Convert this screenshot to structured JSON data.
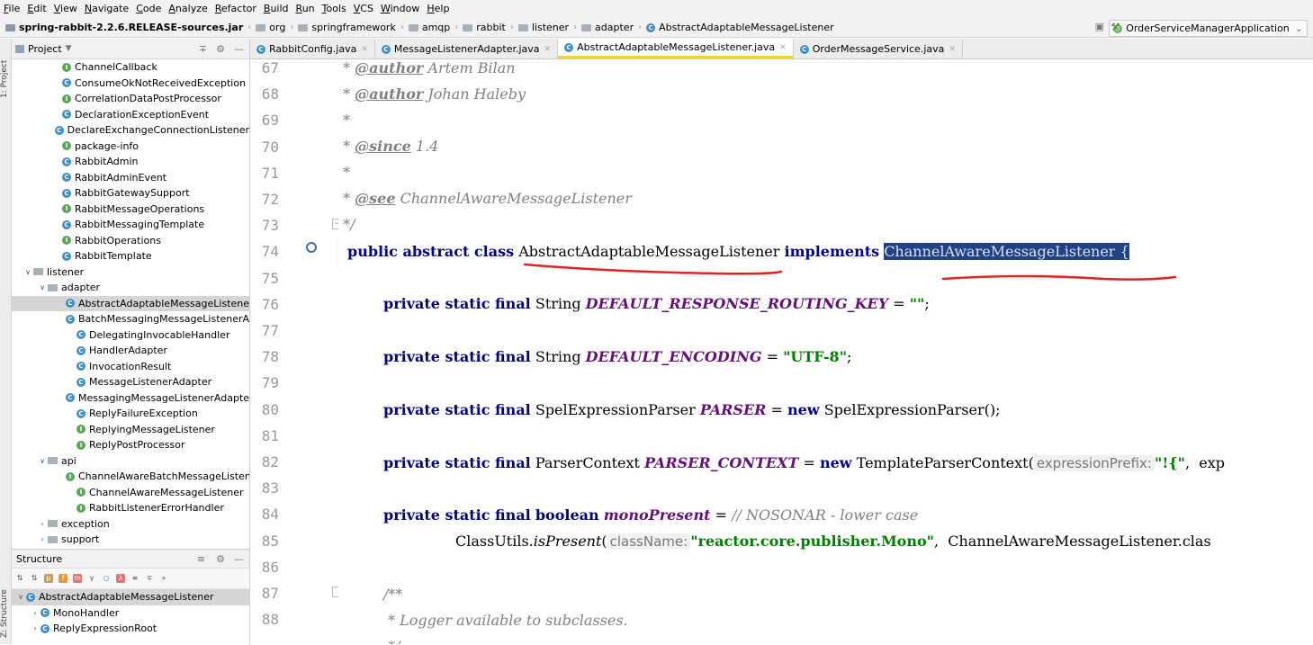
{
  "menu": [
    "File",
    "Edit",
    "View",
    "Navigate",
    "Code",
    "Analyze",
    "Refactor",
    "Build",
    "Run",
    "Tools",
    "VCS",
    "Window",
    "Help"
  ],
  "breadcrumbs": [
    "spring-rabbit-2.2.6.RELEASE-sources.jar",
    "org",
    "springframework",
    "amqp",
    "rabbit",
    "listener",
    "adapter",
    "AbstractAdaptableMessageListener"
  ],
  "run_config": "OrderServiceManagerApplication",
  "left_strip": {
    "project": "1: Project",
    "structure": "Z: Structure"
  },
  "project_panel": {
    "title": "Project",
    "items": [
      {
        "label": "ChannelCallback",
        "indent": 3,
        "icon": "I"
      },
      {
        "label": "ConsumeOkNotReceivedException",
        "indent": 3,
        "icon": "C"
      },
      {
        "label": "CorrelationDataPostProcessor",
        "indent": 3,
        "icon": "I"
      },
      {
        "label": "DeclarationExceptionEvent",
        "indent": 3,
        "icon": "C"
      },
      {
        "label": "DeclareExchangeConnectionListener",
        "indent": 3,
        "icon": "C"
      },
      {
        "label": "package-info",
        "indent": 3,
        "icon": "I"
      },
      {
        "label": "RabbitAdmin",
        "indent": 3,
        "icon": "C"
      },
      {
        "label": "RabbitAdminEvent",
        "indent": 3,
        "icon": "C"
      },
      {
        "label": "RabbitGatewaySupport",
        "indent": 3,
        "icon": "C"
      },
      {
        "label": "RabbitMessageOperations",
        "indent": 3,
        "icon": "I"
      },
      {
        "label": "RabbitMessagingTemplate",
        "indent": 3,
        "icon": "C"
      },
      {
        "label": "RabbitOperations",
        "indent": 3,
        "icon": "I"
      },
      {
        "label": "RabbitTemplate",
        "indent": 3,
        "icon": "C"
      },
      {
        "label": "listener",
        "indent": 1,
        "icon": "folder",
        "arrow": "open"
      },
      {
        "label": "adapter",
        "indent": 2,
        "icon": "folder",
        "arrow": "open"
      },
      {
        "label": "AbstractAdaptableMessageListener",
        "indent": 4,
        "icon": "C",
        "selected": true
      },
      {
        "label": "BatchMessagingMessageListenerAdap",
        "indent": 4,
        "icon": "C"
      },
      {
        "label": "DelegatingInvocableHandler",
        "indent": 4,
        "icon": "C"
      },
      {
        "label": "HandlerAdapter",
        "indent": 4,
        "icon": "C"
      },
      {
        "label": "InvocationResult",
        "indent": 4,
        "icon": "C"
      },
      {
        "label": "MessageListenerAdapter",
        "indent": 4,
        "icon": "C"
      },
      {
        "label": "MessagingMessageListenerAdapter",
        "indent": 4,
        "icon": "C"
      },
      {
        "label": "ReplyFailureException",
        "indent": 4,
        "icon": "C"
      },
      {
        "label": "ReplyingMessageListener",
        "indent": 4,
        "icon": "I"
      },
      {
        "label": "ReplyPostProcessor",
        "indent": 4,
        "icon": "I"
      },
      {
        "label": "api",
        "indent": 2,
        "icon": "folder",
        "arrow": "open"
      },
      {
        "label": "ChannelAwareBatchMessageListener",
        "indent": 4,
        "icon": "I"
      },
      {
        "label": "ChannelAwareMessageListener",
        "indent": 4,
        "icon": "I"
      },
      {
        "label": "RabbitListenerErrorHandler",
        "indent": 4,
        "icon": "I"
      },
      {
        "label": "exception",
        "indent": 2,
        "icon": "folder",
        "arrow": "closed"
      },
      {
        "label": "support",
        "indent": 2,
        "icon": "folder",
        "arrow": "closed"
      }
    ]
  },
  "structure_panel": {
    "title": "Structure",
    "items": [
      {
        "label": "AbstractAdaptableMessageListener",
        "indent": 0,
        "selected": true
      },
      {
        "label": "MonoHandler",
        "indent": 1
      },
      {
        "label": "ReplyExpressionRoot",
        "indent": 1
      }
    ]
  },
  "editor_tabs": [
    {
      "label": "RabbitConfig.java",
      "active": false
    },
    {
      "label": "MessageListenerAdapter.java",
      "active": false
    },
    {
      "label": "AbstractAdaptableMessageListener.java",
      "active": true
    },
    {
      "label": "OrderMessageService.java",
      "active": false
    }
  ],
  "line_numbers": [
    "67",
    "68",
    "69",
    "70",
    "71",
    "72",
    "73",
    "74",
    "75",
    "76",
    "77",
    "78",
    "79",
    "80",
    "81",
    "82",
    "83",
    "84",
    "85",
    "86",
    "87",
    "88"
  ],
  "code": {
    "l67_tag": "@author",
    "l67_name": " Artem Bilan",
    "l68_tag": "@author",
    "l68_name": " Johan Haleby",
    "l70_tag": "@since",
    "l70_ver": " 1.4",
    "l72_tag": "@see",
    "l72_ref": " ChannelAwareMessageListener",
    "l73": " */",
    "l74_kw": "public abstract class",
    "l74_class": " AbstractAdaptableMessageListener ",
    "l74_impl": "implements",
    "l74_iface": "ChannelAwareMessageListener",
    "l74_brace": " {",
    "mods": "private static final",
    "l76_type": " String ",
    "l76_name": "DEFAULT_RESPONSE_ROUTING_KEY",
    "l76_val": "\"\"",
    "l78_name": "DEFAULT_ENCODING",
    "l78_val": "\"UTF-8\"",
    "l80_type": " SpelExpressionParser ",
    "l80_name": "PARSER",
    "l80_new": "new",
    "l80_ctor": " SpelExpressionParser();",
    "l82_type": " ParserContext ",
    "l82_name": "PARSER_CONTEXT",
    "l82_ctor": " TemplateParserContext(",
    "l82_hint": "expressionPrefix:",
    "l82_val": "\"!{\"",
    "l82_tail": ",  exp",
    "l84_type": "boolean",
    "l84_name": "monoPresent",
    "l84_comment": "// NOSONAR - lower case",
    "l85_call": "ClassUtils.",
    "l85_method": "isPresent",
    "l85_hint": "className:",
    "l85_val": "\"reactor.core.publisher.Mono\"",
    "l85_tail": ",  ChannelAwareMessageListener.clas",
    "l87": "/**",
    "l88": " * Logger available to subclasses."
  },
  "colors": {
    "keyword": "#000080",
    "comment": "#808080",
    "string": "#008000",
    "constant": "#660e7a",
    "selection": "#214283",
    "annotation": "#e32222"
  }
}
